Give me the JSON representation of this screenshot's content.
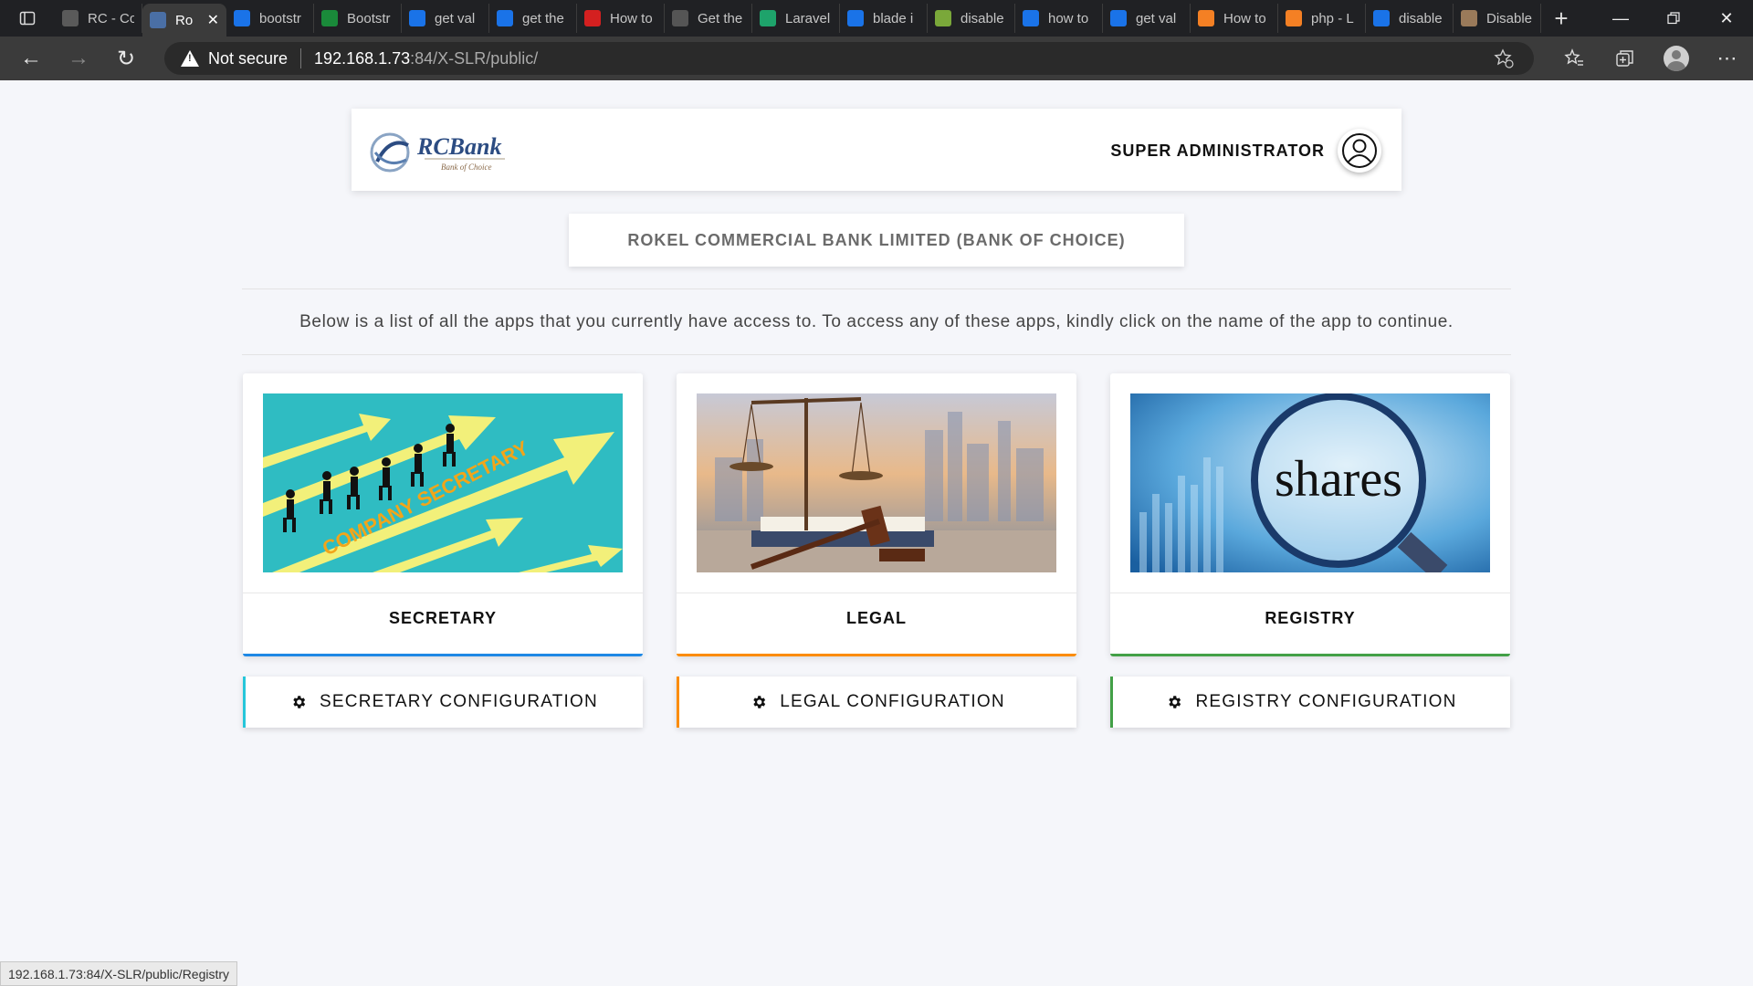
{
  "browser": {
    "tabs": [
      {
        "title": "RC - Co",
        "icon": "site-icon",
        "color": "#5a5a5a"
      },
      {
        "title": "Ro",
        "icon": "rcbank-icon",
        "color": "#4a6fa5",
        "active": true
      },
      {
        "title": "bootstr",
        "icon": "bing-icon",
        "color": "#1a73e8"
      },
      {
        "title": "Bootstr",
        "icon": "w-icon",
        "color": "#1a8a3a"
      },
      {
        "title": "get val",
        "icon": "bing-icon",
        "color": "#1a73e8"
      },
      {
        "title": "get the",
        "icon": "bing-icon",
        "color": "#1a73e8"
      },
      {
        "title": "How to",
        "icon": "v-icon",
        "color": "#d42020"
      },
      {
        "title": "Get the",
        "icon": "td-icon",
        "color": "#555555"
      },
      {
        "title": "Laravel",
        "icon": "r-icon",
        "color": "#1ea36b"
      },
      {
        "title": "blade i",
        "icon": "bing-icon",
        "color": "#1a73e8"
      },
      {
        "title": "disable",
        "icon": "star-icon",
        "color": "#7aa83a"
      },
      {
        "title": "how to",
        "icon": "bing-icon",
        "color": "#1a73e8"
      },
      {
        "title": "get val",
        "icon": "bing-icon",
        "color": "#1a73e8"
      },
      {
        "title": "How to",
        "icon": "stackoverflow-icon",
        "color": "#f48024"
      },
      {
        "title": "php - L",
        "icon": "stackoverflow-icon",
        "color": "#f48024"
      },
      {
        "title": "disable",
        "icon": "bing-icon",
        "color": "#1a73e8"
      },
      {
        "title": "Disable",
        "icon": "stackoverflow-icon",
        "color": "#9a7a5a"
      }
    ],
    "security_label": "Not secure",
    "url_host": "192.168.1.73",
    "url_rest": ":84/X-SLR/public/",
    "status_url": "192.168.1.73:84/X-SLR/public/Registry"
  },
  "header": {
    "logo_text": "RCBank",
    "logo_tagline": "Bank of Choice",
    "user_role": "SUPER ADMINISTRATOR"
  },
  "bank_name": "ROKEL COMMERCIAL BANK LIMITED (BANK OF CHOICE)",
  "intro_text": "Below is a list of all the apps that you currently have access to. To access any of these apps, kindly click on the name of the app to continue.",
  "apps": [
    {
      "name": "SECRETARY",
      "image_text": "COMPANY SECRETARY",
      "accent": "#1e88e5",
      "config_label": "SECRETARY CONFIGURATION",
      "config_accent": "#26c6da"
    },
    {
      "name": "LEGAL",
      "image_text": "",
      "accent": "#fb8c00",
      "config_label": "LEGAL CONFIGURATION",
      "config_accent": "#fb8c00"
    },
    {
      "name": "REGISTRY",
      "image_text": "shares",
      "accent": "#43a047",
      "config_label": "REGISTRY CONFIGURATION",
      "config_accent": "#43a047"
    }
  ]
}
